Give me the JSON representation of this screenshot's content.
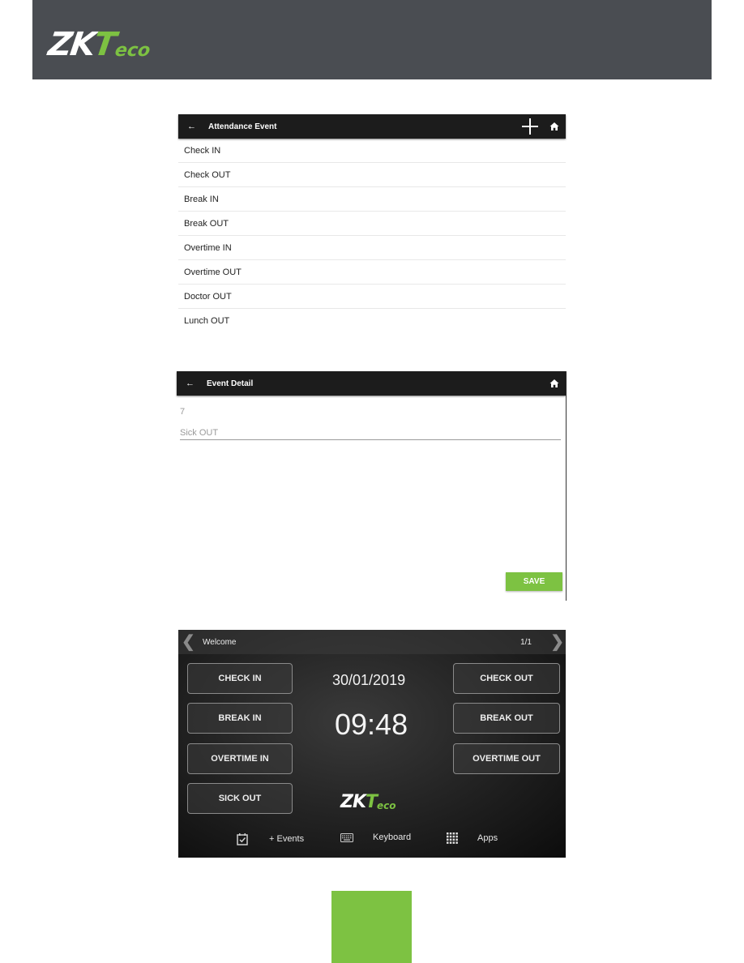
{
  "header": {
    "logo_primary": "ZK",
    "logo_accent_t": "T",
    "logo_accent_rest": "eco",
    "background_color": "#4a4d52",
    "brand_green": "#7dc242"
  },
  "attendance_event_screen": {
    "title": "Attendance Event",
    "icons": [
      "back-arrow-icon",
      "plus-icon",
      "home-icon"
    ],
    "items": [
      "Check IN",
      "Check OUT",
      "Break IN",
      "Break OUT",
      "Overtime IN",
      "Overtime OUT",
      "Doctor OUT",
      "Lunch OUT"
    ]
  },
  "event_detail_screen": {
    "title": "Event Detail",
    "id_value": "7",
    "name_value": "Sick OUT",
    "save_label": "SAVE"
  },
  "welcome_screen": {
    "title": "Welcome",
    "page_indicator": "1/1",
    "date": "30/01/2019",
    "time": "09:48",
    "left_buttons": [
      "CHECK IN",
      "BREAK IN",
      "OVERTIME IN",
      "SICK OUT"
    ],
    "right_buttons": [
      "CHECK OUT",
      "BREAK OUT",
      "OVERTIME OUT"
    ],
    "bottom_bar": [
      {
        "icon": "calendar-check-icon",
        "label": "+ Events"
      },
      {
        "icon": "keyboard-icon",
        "label": "Keyboard"
      },
      {
        "icon": "apps-grid-icon",
        "label": "Apps"
      }
    ]
  }
}
